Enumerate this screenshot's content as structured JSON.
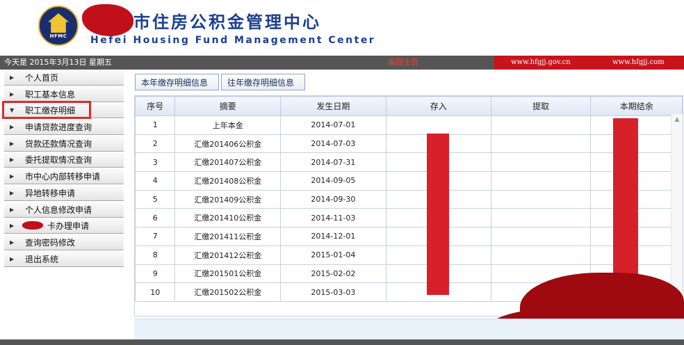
{
  "header": {
    "logo_text": "HFMC",
    "logo_icon": "house-icon",
    "title_cn": "市住房公积金管理中心",
    "title_en": "Hefei Housing Fund Management Center"
  },
  "infobar": {
    "today": "今天是 2015年3月13日 星期五",
    "home_link": "返回主页",
    "domain1": "www.hfgjj.gov.cn",
    "domain2": "www.hfgjj.com"
  },
  "sidebar": {
    "items": [
      {
        "label": "个人首页",
        "icon": "arrow-right-icon"
      },
      {
        "label": "职工基本信息",
        "icon": "arrow-right-icon"
      },
      {
        "label": "职工缴存明细",
        "icon": "arrow-down-icon",
        "active": true
      },
      {
        "label": "申请贷款进度查询",
        "icon": "arrow-right-icon"
      },
      {
        "label": "贷款还款情况查询",
        "icon": "arrow-right-icon"
      },
      {
        "label": "委托提取情况查询",
        "icon": "arrow-right-icon"
      },
      {
        "label": "市中心内部转移申请",
        "icon": "arrow-right-icon"
      },
      {
        "label": "异地转移申请",
        "icon": "arrow-right-icon"
      },
      {
        "label": "个人信息修改申请",
        "icon": "arrow-right-icon"
      },
      {
        "label": "卡办理申请",
        "icon": "arrow-right-icon"
      },
      {
        "label": "查询密码修改",
        "icon": "arrow-right-icon"
      },
      {
        "label": "退出系统",
        "icon": "arrow-right-icon"
      }
    ]
  },
  "tabs": [
    "本年缴存明细信息",
    "往年缴存明细信息"
  ],
  "table": {
    "headers": [
      "序号",
      "摘要",
      "发生日期",
      "存入",
      "提取",
      "本期结余"
    ],
    "rows": [
      {
        "seq": "1",
        "summary": "上年本金",
        "date": "2014-07-01"
      },
      {
        "seq": "2",
        "summary": "汇缴201406公积金",
        "date": "2014-07-03"
      },
      {
        "seq": "3",
        "summary": "汇缴201407公积金",
        "date": "2014-07-31"
      },
      {
        "seq": "4",
        "summary": "汇缴201408公积金",
        "date": "2014-09-05"
      },
      {
        "seq": "5",
        "summary": "汇缴201409公积金",
        "date": "2014-09-30"
      },
      {
        "seq": "6",
        "summary": "汇缴201410公积金",
        "date": "2014-11-03"
      },
      {
        "seq": "7",
        "summary": "汇缴201411公积金",
        "date": "2014-12-01"
      },
      {
        "seq": "8",
        "summary": "汇缴201412公积金",
        "date": "2015-01-04"
      },
      {
        "seq": "9",
        "summary": "汇缴201501公积金",
        "date": "2015-02-02"
      },
      {
        "seq": "10",
        "summary": "汇缴201502公积金",
        "date": "2015-03-03"
      }
    ]
  },
  "colors": {
    "title_blue": "#1c3f94",
    "infobar_gray": "#555555",
    "domain_red": "#c8141d",
    "redaction_red": "#d8202a"
  }
}
